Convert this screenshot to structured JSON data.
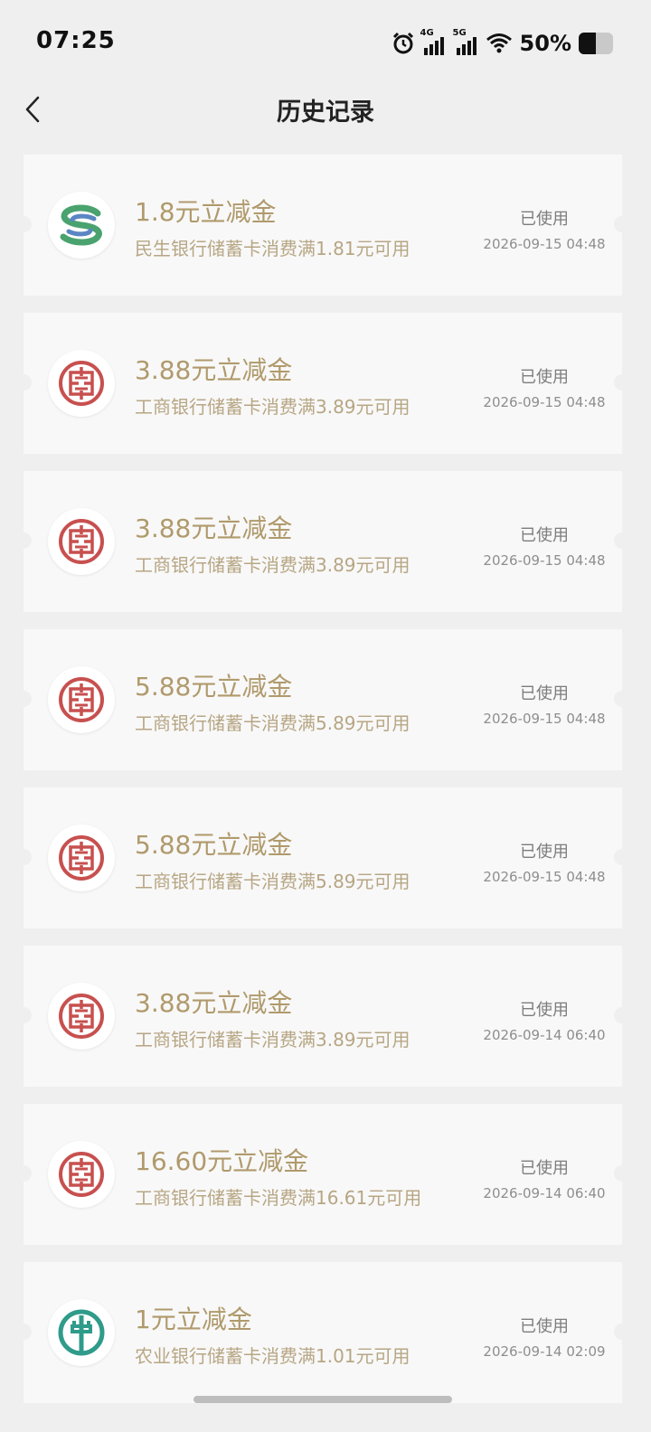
{
  "status_bar": {
    "time": "07:25",
    "network_1": "4G",
    "network_2": "5G",
    "battery": "50%",
    "battery_level": 0.5
  },
  "header": {
    "back_icon": "chevron-left-icon",
    "title": "历史记录"
  },
  "colors": {
    "amount": "#b09a6c",
    "desc": "#b7a684",
    "icbc_red": "#c7504f",
    "cmbc_green": "#4aa36f",
    "cmbc_blue": "#5b86c4",
    "abc_teal": "#2f9b8a"
  },
  "records": [
    {
      "bank": "cmbc",
      "icon": "minsheng-bank-logo-icon",
      "amount": "1.8元立减金",
      "desc": "民生银行储蓄卡消费满1.81元可用",
      "status": "已使用",
      "time": "2026-09-15 04:48"
    },
    {
      "bank": "icbc",
      "icon": "icbc-logo-icon",
      "amount": "3.88元立减金",
      "desc": "工商银行储蓄卡消费满3.89元可用",
      "status": "已使用",
      "time": "2026-09-15 04:48"
    },
    {
      "bank": "icbc",
      "icon": "icbc-logo-icon",
      "amount": "3.88元立减金",
      "desc": "工商银行储蓄卡消费满3.89元可用",
      "status": "已使用",
      "time": "2026-09-15 04:48"
    },
    {
      "bank": "icbc",
      "icon": "icbc-logo-icon",
      "amount": "5.88元立减金",
      "desc": "工商银行储蓄卡消费满5.89元可用",
      "status": "已使用",
      "time": "2026-09-15 04:48"
    },
    {
      "bank": "icbc",
      "icon": "icbc-logo-icon",
      "amount": "5.88元立减金",
      "desc": "工商银行储蓄卡消费满5.89元可用",
      "status": "已使用",
      "time": "2026-09-15 04:48"
    },
    {
      "bank": "icbc",
      "icon": "icbc-logo-icon",
      "amount": "3.88元立减金",
      "desc": "工商银行储蓄卡消费满3.89元可用",
      "status": "已使用",
      "time": "2026-09-14 06:40"
    },
    {
      "bank": "icbc",
      "icon": "icbc-logo-icon",
      "amount": "16.60元立减金",
      "desc": "工商银行储蓄卡消费满16.61元可用",
      "status": "已使用",
      "time": "2026-09-14 06:40"
    },
    {
      "bank": "abc",
      "icon": "abc-bank-logo-icon",
      "amount": "1元立减金",
      "desc": "农业银行储蓄卡消费满1.01元可用",
      "status": "已使用",
      "time": "2026-09-14 02:09"
    }
  ]
}
